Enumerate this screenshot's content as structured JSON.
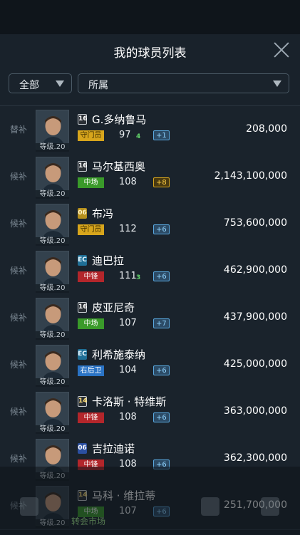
{
  "header": {
    "title": "我的球员列表"
  },
  "filters": {
    "type_label": "全部",
    "club_label": "所属"
  },
  "players": [
    {
      "status": "替补",
      "level": "等级.20",
      "card": "16",
      "card_class": "c16",
      "name": "G.多纳鲁马",
      "position": "守门员",
      "pos_class": "gk",
      "rating": "97",
      "sub": "4",
      "bonus": "+1",
      "bonus_class": "blue",
      "price": "208,000"
    },
    {
      "status": "候补",
      "level": "等级.20",
      "card": "16",
      "card_class": "c16",
      "name": "马尔基西奥",
      "position": "中场",
      "pos_class": "mf",
      "rating": "108",
      "sub": "",
      "bonus": "+8",
      "bonus_class": "gold",
      "price": "2,143,100,000"
    },
    {
      "status": "候补",
      "level": "等级.20",
      "card": "06",
      "card_class": "c06",
      "name": "布冯",
      "position": "守门员",
      "pos_class": "gk",
      "rating": "112",
      "sub": "",
      "bonus": "+6",
      "bonus_class": "blue",
      "price": "753,600,000"
    },
    {
      "status": "候补",
      "level": "等级.20",
      "card": "EC",
      "card_class": "cec",
      "name": "迪巴拉",
      "position": "中锋",
      "pos_class": "fw",
      "rating": "111",
      "sub": "3",
      "bonus": "+6",
      "bonus_class": "blue",
      "price": "462,900,000"
    },
    {
      "status": "候补",
      "level": "等级.20",
      "card": "16",
      "card_class": "c16",
      "name": "皮亚尼奇",
      "position": "中场",
      "pos_class": "mf",
      "rating": "107",
      "sub": "",
      "bonus": "+7",
      "bonus_class": "blue",
      "price": "437,900,000"
    },
    {
      "status": "候补",
      "level": "等级.20",
      "card": "EC",
      "card_class": "cec",
      "name": "利希施泰纳",
      "position": "右后卫",
      "pos_class": "df",
      "rating": "104",
      "sub": "",
      "bonus": "+6",
      "bonus_class": "blue",
      "price": "425,000,000"
    },
    {
      "status": "候补",
      "level": "等级.20",
      "card": "14",
      "card_class": "c14",
      "name": "卡洛斯 · 特维斯",
      "position": "中锋",
      "pos_class": "fw",
      "rating": "108",
      "sub": "",
      "bonus": "+6",
      "bonus_class": "blue",
      "price": "363,000,000"
    },
    {
      "status": "候补",
      "level": "等级.20",
      "card": "06",
      "card_class": "c06b",
      "name": "吉拉迪诺",
      "position": "中锋",
      "pos_class": "fw",
      "rating": "108",
      "sub": "",
      "bonus": "+6",
      "bonus_class": "blue",
      "price": "362,300,000"
    },
    {
      "status": "候补",
      "level": "等级.20",
      "card": "14",
      "card_class": "c14",
      "name": "马科 · 维拉蒂",
      "position": "中场",
      "pos_class": "mf",
      "rating": "107",
      "sub": "",
      "bonus": "+6",
      "bonus_class": "blue",
      "price": "251,700,000"
    }
  ],
  "bottom_nav": {
    "label": "转会市场"
  }
}
